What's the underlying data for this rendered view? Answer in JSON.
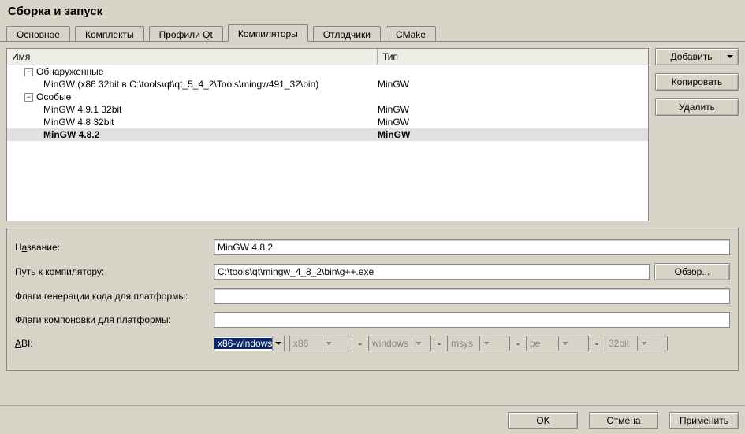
{
  "title": "Сборка и запуск",
  "tabs": {
    "general": "Основное",
    "kits": "Комплекты",
    "qt_profiles": "Профили Qt",
    "compilers": "Компиляторы",
    "debuggers": "Отладчики",
    "cmake": "CMake"
  },
  "headers": {
    "name": "Имя",
    "type": "Тип"
  },
  "tree": {
    "auto_group": "Обнаруженные",
    "auto_item_name": "MinGW (x86 32bit в C:\\tools\\qt\\qt_5_4_2\\Tools\\mingw491_32\\bin)",
    "auto_item_type": "MinGW",
    "manual_group": "Особые",
    "m1_name": "MinGW 4.9.1 32bit",
    "m1_type": "MinGW",
    "m2_name": "MinGW 4.8 32bit",
    "m2_type": "MinGW",
    "m3_name": "MinGW 4.8.2",
    "m3_type": "MinGW"
  },
  "side": {
    "add": "Добавить",
    "copy": "Копировать",
    "remove": "Удалить"
  },
  "form": {
    "name_label_pre": "Н",
    "name_label_u": "а",
    "name_label_post": "звание:",
    "name_value": "MinGW 4.8.2",
    "path_label_pre": "Путь к ",
    "path_label_u": "к",
    "path_label_post": "омпилятору:",
    "path_value": "C:\\tools\\qt\\mingw_4_8_2\\bin\\g++.exe",
    "browse": "Обзор...",
    "codegen_label": "Флаги генерации кода для платформы:",
    "link_label": "Флаги компоновки для платформы:",
    "abi_label_u": "A",
    "abi_label_post": "BI:",
    "abi_main": "x86-windows",
    "abi_arch": "x86",
    "abi_os": "windows",
    "abi_flavor": "msys",
    "abi_format": "pe",
    "abi_width": "32bit"
  },
  "footer": {
    "ok": "OK",
    "cancel": "Отмена",
    "apply": "Применить"
  }
}
